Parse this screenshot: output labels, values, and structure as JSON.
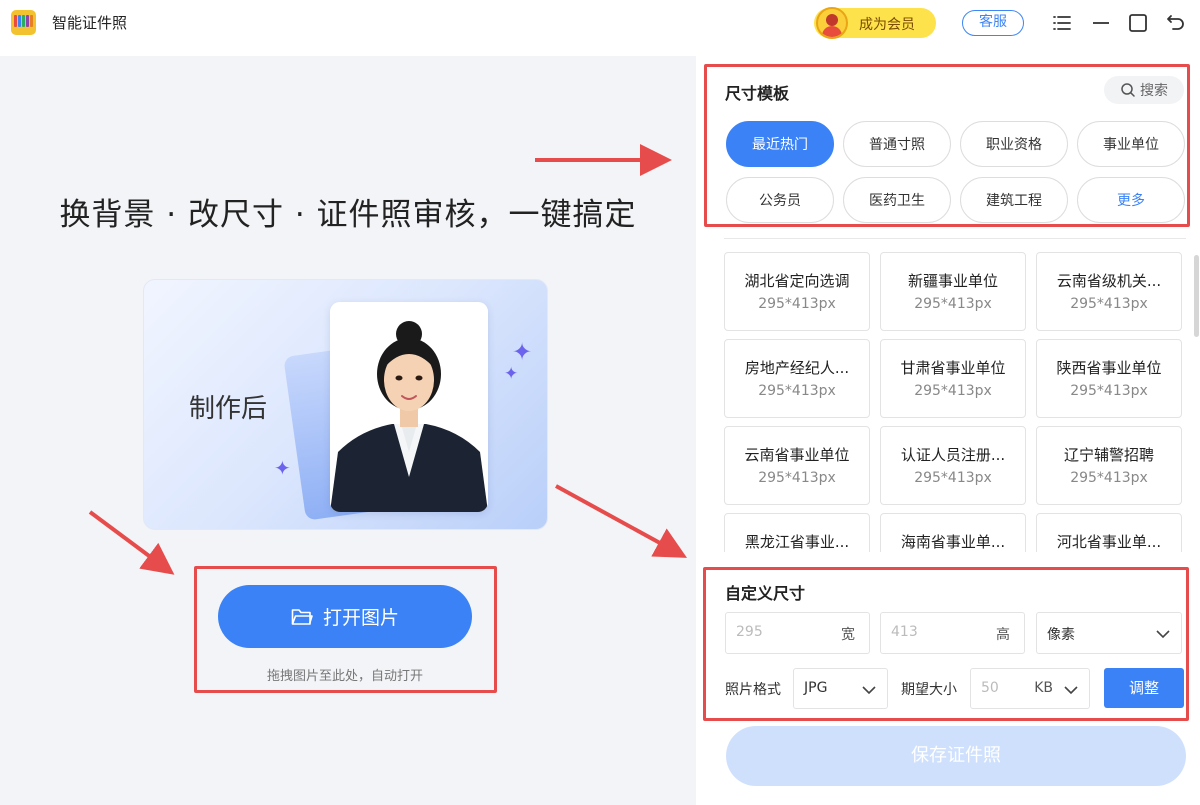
{
  "app": {
    "title": "智能证件照"
  },
  "header": {
    "vip_label": "成为会员",
    "service_label": "客服"
  },
  "left": {
    "headline": "换背景 · 改尺寸 · 证件照审核，一键搞定",
    "preview_label": "制作后",
    "open_button": "打开图片",
    "open_hint": "拖拽图片至此处，自动打开"
  },
  "templates": {
    "title": "尺寸模板",
    "search_label": "搜索",
    "categories": [
      {
        "label": "最近热门",
        "active": true
      },
      {
        "label": "普通寸照"
      },
      {
        "label": "职业资格"
      },
      {
        "label": "事业单位"
      },
      {
        "label": "公务员"
      },
      {
        "label": "医药卫生"
      },
      {
        "label": "建筑工程"
      },
      {
        "label": "更多"
      }
    ],
    "items": [
      {
        "name": "湖北省定向选调",
        "size": "295*413px"
      },
      {
        "name": "新疆事业单位",
        "size": "295*413px"
      },
      {
        "name": "云南省级机关...",
        "size": "295*413px"
      },
      {
        "name": "房地产经纪人...",
        "size": "295*413px"
      },
      {
        "name": "甘肃省事业单位",
        "size": "295*413px"
      },
      {
        "name": "陕西省事业单位",
        "size": "295*413px"
      },
      {
        "name": "云南省事业单位",
        "size": "295*413px"
      },
      {
        "name": "认证人员注册...",
        "size": "295*413px"
      },
      {
        "name": "辽宁辅警招聘",
        "size": "295*413px"
      },
      {
        "name": "黑龙江省事业...",
        "size": ""
      },
      {
        "name": "海南省事业单...",
        "size": ""
      },
      {
        "name": "河北省事业单...",
        "size": ""
      }
    ]
  },
  "custom": {
    "title": "自定义尺寸",
    "width_value": "295",
    "width_label": "宽",
    "height_value": "413",
    "height_label": "高",
    "unit_select": "像素",
    "format_label": "照片格式",
    "format_select": "JPG",
    "size_label": "期望大小",
    "size_value": "50",
    "size_unit": "KB",
    "adjust_button": "调整",
    "save_button": "保存证件照"
  },
  "colors": {
    "primary": "#3b82f6",
    "annotation": "#e74c4c",
    "vip": "#fde24b"
  }
}
